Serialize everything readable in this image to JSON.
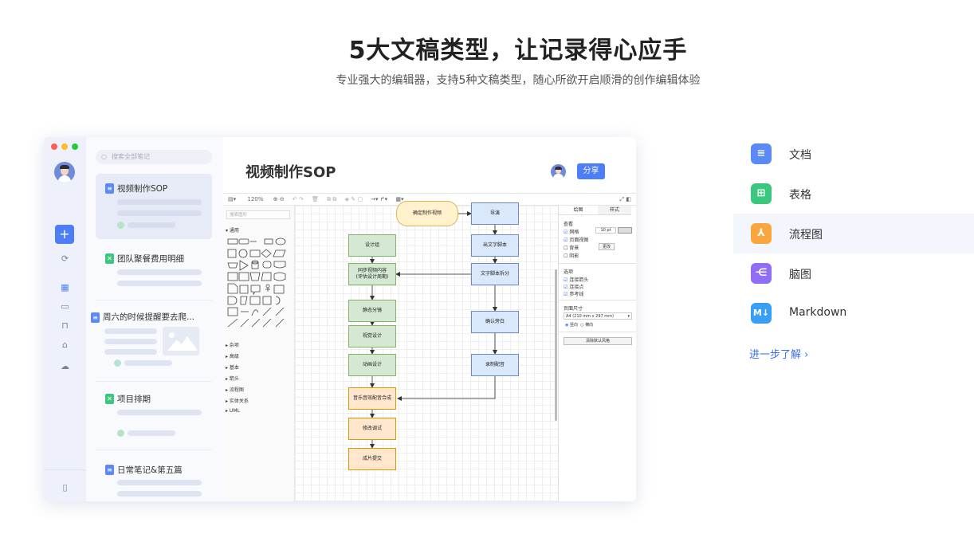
{
  "header": {
    "title": "5大文稿类型，让记录得心应手",
    "subtitle": "专业强大的编辑器，支持5种文稿类型，随心所欲开启顺滑的创作编辑体验"
  },
  "app": {
    "search_placeholder": "搜索全部笔记",
    "notes": [
      {
        "title": "视频制作SOP",
        "icon": "doc-icon",
        "color": "#5b8af7"
      },
      {
        "title": "团队聚餐费用明细",
        "icon": "sheet-icon",
        "color": "#3cc77f"
      },
      {
        "title": "周六的时候提醒要去爬...",
        "icon": "doc-icon",
        "color": "#5b8af7"
      },
      {
        "title": "项目排期",
        "icon": "sheet-icon",
        "color": "#3cc77f"
      },
      {
        "title": "日常笔记&第五篇",
        "icon": "doc-icon",
        "color": "#5b8af7"
      }
    ],
    "doc_title": "视频制作SOP",
    "share_label": "分享",
    "toolbar": {
      "zoom": "120%"
    },
    "shapes_panel": {
      "search_placeholder": "搜索图形",
      "groups": [
        "通用",
        "杂项",
        "高级",
        "基本",
        "箭头",
        "流程图",
        "实体关系",
        "UML"
      ]
    },
    "flow_nodes": {
      "start": "确定制作视频",
      "director": "导演",
      "script": "出文字脚本",
      "split": "文字脚本拆分",
      "design": "设计组",
      "sync": "同步视频内容\n(评估设计周期)",
      "static": "静态分镜",
      "visual": "视觉设计",
      "motion": "动画设计",
      "confirm": "确认旁白",
      "record": "录制配音",
      "music": "音乐音效配音合成",
      "revise": "修改调试",
      "final": "成片提交"
    },
    "props": {
      "tabs": [
        "绘图",
        "样式"
      ],
      "view_heading": "查看",
      "options": [
        "网格",
        "页面视图",
        "背景",
        "阴影"
      ],
      "grid_size": "10 pt",
      "edit_button": "更改",
      "options_heading": "选项",
      "options2": [
        "连接箭头",
        "连接点",
        "参考线"
      ],
      "paper_heading": "页面尺寸",
      "paper_size": "A4 (210 mm x 297 mm)",
      "orientation": [
        "竖向",
        "横向"
      ],
      "reset_button": "清除默认风格"
    }
  },
  "types": [
    {
      "label": "文档",
      "icon": "doc-icon",
      "color": "#5b8af7",
      "glyph": "≡"
    },
    {
      "label": "表格",
      "icon": "table-icon",
      "color": "#3cc77f",
      "glyph": "⊞"
    },
    {
      "label": "流程图",
      "icon": "flowchart-icon",
      "color": "#f9a63f",
      "glyph": "⅄"
    },
    {
      "label": "脑图",
      "icon": "mindmap-icon",
      "color": "#8f6ef5",
      "glyph": "⋲"
    },
    {
      "label": "Markdown",
      "icon": "markdown-icon",
      "color": "#3a9ef5",
      "glyph": "M"
    }
  ],
  "learn_more": "进一步了解 ›"
}
